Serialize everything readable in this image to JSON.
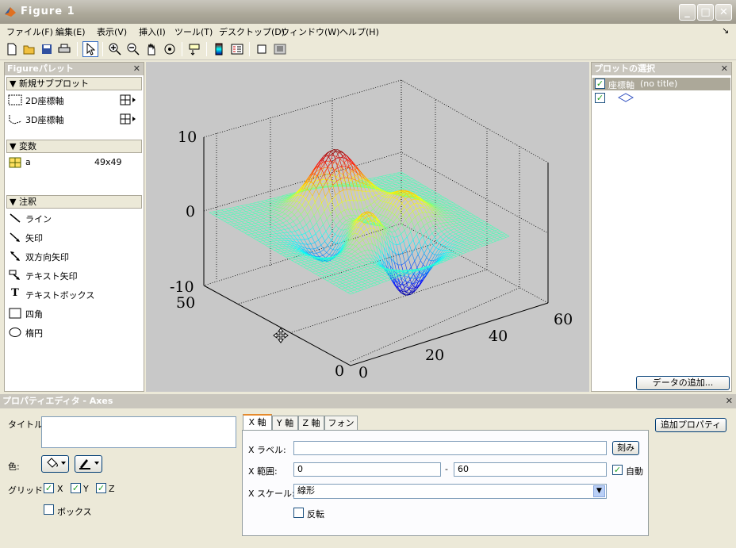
{
  "window": {
    "title": "Figure 1",
    "min_glyph": "_",
    "max_glyph": "□",
    "close_glyph": "✕"
  },
  "menu": [
    "ファイル(F)",
    "編集(E)",
    "表示(V)",
    "挿入(I)",
    "ツール(T)",
    "デスクトップ(D)",
    "ウィンドウ(W)",
    "ヘルプ(H)"
  ],
  "menu_arrow": "↘",
  "palette": {
    "title": "Figureパレット",
    "close": "✕",
    "sections": {
      "subplot": "新規サブプロット",
      "variables": "変数",
      "annotations": "注釈"
    },
    "subplots": [
      {
        "label": "2D座標軸"
      },
      {
        "label": "3D座標軸"
      }
    ],
    "variable": {
      "name": "a",
      "size": "49x49"
    },
    "annotations": [
      "ライン",
      "矢印",
      "双方向矢印",
      "テキスト矢印",
      "テキストボックス",
      "四角",
      "楕円"
    ]
  },
  "plot": {
    "z_ticks": [
      "10",
      "0",
      "-10"
    ],
    "y_ticks": [
      "50",
      "0"
    ],
    "x_ticks": [
      "0",
      "20",
      "40",
      "60"
    ]
  },
  "browser": {
    "title": "プロットの選択",
    "close": "✕",
    "items": [
      {
        "label": "座標軸",
        "sub": "(no title)"
      }
    ],
    "add_data": "データの追加..."
  },
  "props": {
    "title": "プロパティエディタ - Axes",
    "close": "✕",
    "title_label": "タイトル:",
    "color_label": "色:",
    "grid_label": "グリッド:",
    "grid_x": "X",
    "grid_y": "Y",
    "grid_z": "Z",
    "box_label": "ボックス",
    "tabs": [
      "X 軸",
      "Y 軸",
      "Z 軸",
      "フォント"
    ],
    "xlabel_label": "X ラベル:",
    "ticks_button": "刻み",
    "xrange_label": "X 範囲:",
    "xmin": "0",
    "dash": "-",
    "xmax": "60",
    "auto_label": "自動",
    "xscale_label": "X スケール:",
    "xscale_value": "線形",
    "reverse_label": "反転",
    "more_props": "追加プロパティ"
  }
}
